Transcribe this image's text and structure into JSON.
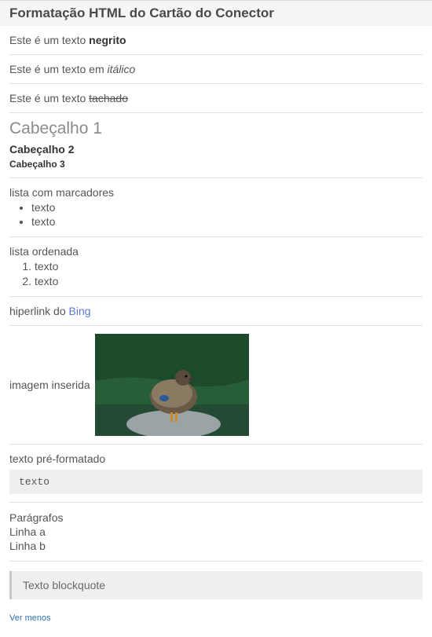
{
  "card": {
    "title": "Formatação HTML do Cartão do Conector"
  },
  "sections": {
    "bold": {
      "prefix": "Este é um texto ",
      "strong": "negrito"
    },
    "italic": {
      "prefix": "Este é um texto em ",
      "em": "itálico"
    },
    "strike": {
      "prefix": "Este é um texto ",
      "struck": "tachado"
    },
    "headers": {
      "h1": "Cabeçalho 1",
      "h2": "Cabeçalho 2",
      "h3": "Cabeçalho 3"
    },
    "ul": {
      "label": "lista com marcadores",
      "items": [
        "texto",
        "texto"
      ]
    },
    "ol": {
      "label": "lista ordenada",
      "items": [
        "texto",
        "texto"
      ]
    },
    "link": {
      "prefix": "hiperlink do ",
      "text": "Bing"
    },
    "image": {
      "label": "imagem inserida",
      "alt": "duck-photo"
    },
    "pre": {
      "label": "texto pré-formatado",
      "text": "texto"
    },
    "paragraphs": {
      "label": "Parágrafos",
      "lines": [
        "Linha a",
        "Linha b"
      ]
    },
    "blockquote": {
      "text": "Texto blockquote"
    },
    "seeLess": "Ver menos"
  }
}
